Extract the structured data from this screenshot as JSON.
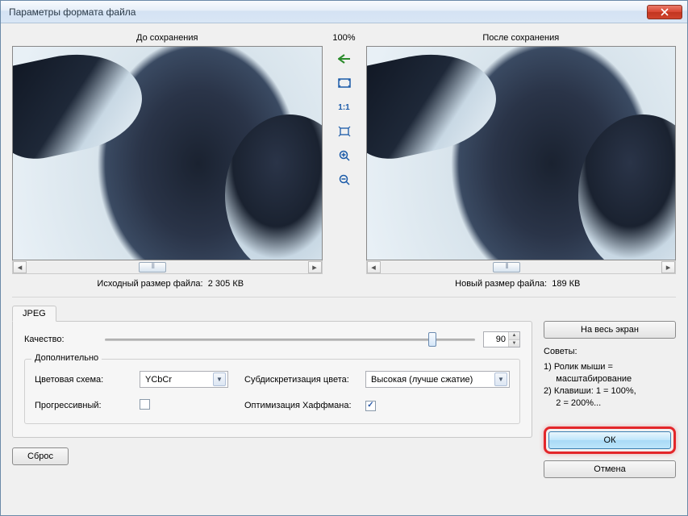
{
  "window": {
    "title": "Параметры формата файла"
  },
  "preview": {
    "left_label": "До сохранения",
    "right_label": "После сохранения",
    "zoom": "100%",
    "original_size_label": "Исходный размер файла:",
    "original_size_value": "2 305 КВ",
    "new_size_label": "Новый размер файла:",
    "new_size_value": "189 КВ"
  },
  "tools": {
    "back": "←",
    "fit": "☐",
    "one_to_one": "1:1",
    "full": "◇",
    "zoom_in": "⊕",
    "zoom_out": "⊖"
  },
  "tab": {
    "name": "JPEG"
  },
  "quality": {
    "label": "Качество:",
    "value": "90"
  },
  "advanced": {
    "legend": "Дополнительно",
    "color_scheme_label": "Цветовая схема:",
    "color_scheme_value": "YCbCr",
    "subsample_label": "Субдискретизация цвета:",
    "subsample_value": "Высокая (лучше сжатие)",
    "progressive_label": "Прогрессивный:",
    "huffman_label": "Оптимизация Хаффмана:"
  },
  "buttons": {
    "fullscreen": "На весь экран",
    "reset": "Сброс",
    "ok": "ОК",
    "cancel": "Отмена"
  },
  "tips": {
    "label": "Советы:",
    "line1": "1) Ролик мыши =",
    "line1b": "     масштабирование",
    "line2": "2) Клавиши: 1 = 100%,",
    "line2b": "     2 = 200%..."
  }
}
